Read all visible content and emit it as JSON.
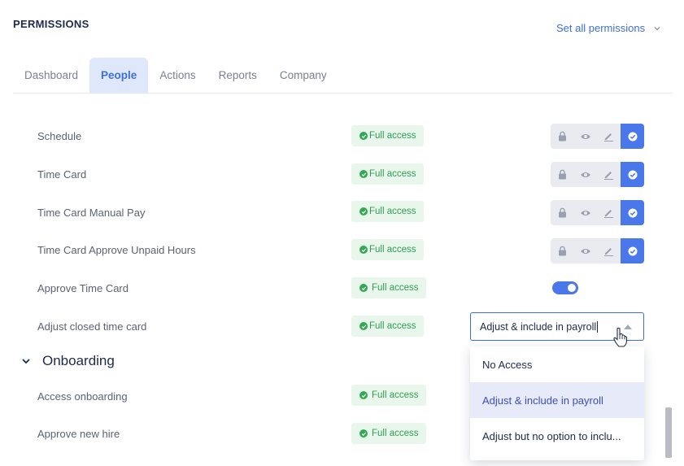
{
  "header": {
    "title": "PERMISSIONS",
    "set_all_label": "Set all permissions"
  },
  "tabs": [
    {
      "label": "Dashboard",
      "active": false
    },
    {
      "label": "People",
      "active": true
    },
    {
      "label": "Actions",
      "active": false
    },
    {
      "label": "Reports",
      "active": false
    },
    {
      "label": "Company",
      "active": false
    }
  ],
  "rows": [
    {
      "label": "Schedule",
      "badge": "Full access",
      "control": "level",
      "selected": "full"
    },
    {
      "label": "Time Card",
      "badge": "Full access",
      "control": "level",
      "selected": "full"
    },
    {
      "label": "Time Card Manual Pay",
      "badge": "Full access",
      "control": "level",
      "selected": "full"
    },
    {
      "label": "Time Card Approve Unpaid Hours",
      "badge": "Full access",
      "control": "level",
      "selected": "full"
    },
    {
      "label": "Approve Time Card",
      "badge": "Full access",
      "control": "toggle",
      "on": true
    },
    {
      "label": "Adjust closed time card",
      "badge": "Full access",
      "control": "select",
      "value": "Adjust & include in payroll"
    }
  ],
  "section": {
    "title": "Onboarding",
    "expanded": true
  },
  "section_rows": [
    {
      "label": "Access onboarding",
      "badge": "Full access"
    },
    {
      "label": "Approve new hire",
      "badge": "Full access"
    }
  ],
  "dropdown": {
    "options": [
      "No Access",
      "Adjust & include in payroll",
      "Adjust but no option to inclu..."
    ],
    "selected_index": 1
  },
  "colors": {
    "accent": "#4a78ea",
    "success": "#34a853",
    "badge_bg": "#e8f6ec",
    "tab_active_bg": "#dfe7fb"
  },
  "icons": {
    "levels": [
      "lock-icon",
      "eye-icon",
      "pencil-icon",
      "check-circle-icon"
    ]
  }
}
